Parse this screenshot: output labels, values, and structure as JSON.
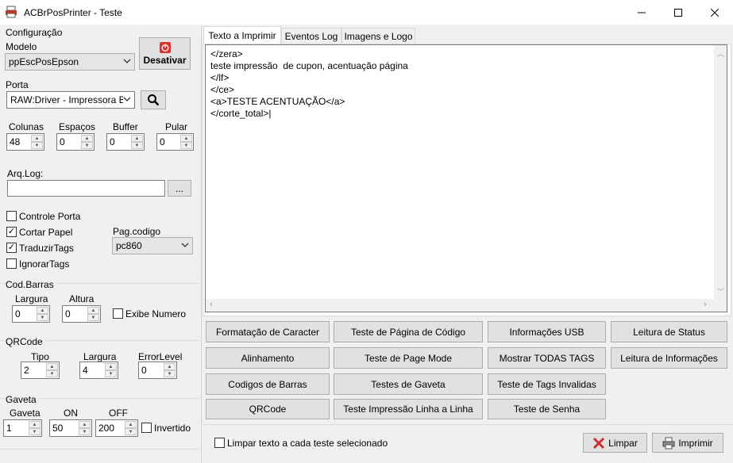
{
  "window": {
    "title": "ACBrPosPrinter - Teste",
    "minimize": "—",
    "maximize": "☐",
    "close": "✕"
  },
  "config": {
    "section_label": "Configuração",
    "modelo_label": "Modelo",
    "modelo_value": "ppEscPosEpson",
    "desativar_label": "Desativar",
    "porta_label": "Porta",
    "porta_value": "RAW:Driver - Impressora B",
    "colunas_label": "Colunas",
    "colunas_value": "48",
    "espacos_label": "Espaços",
    "espacos_value": "0",
    "buffer_label": "Buffer",
    "buffer_value": "0",
    "pular_label": "Pular",
    "pular_value": "0",
    "arqlog_label": "Arq.Log:",
    "arqlog_value": "",
    "browse_label": "...",
    "controle_porta_label": "Controle Porta",
    "controle_porta_checked": false,
    "cortar_papel_label": "Cortar Papel",
    "cortar_papel_checked": true,
    "traduzir_tags_label": "TraduzirTags",
    "traduzir_tags_checked": true,
    "ignorar_tags_label": "IgnorarTags",
    "ignorar_tags_checked": false,
    "pagcodigo_label": "Pag.codigo",
    "pagcodigo_value": "pc860"
  },
  "codbarras": {
    "section_label": "Cod.Barras",
    "largura_label": "Largura",
    "largura_value": "0",
    "altura_label": "Altura",
    "altura_value": "0",
    "exibe_numero_label": "Exibe Numero",
    "exibe_numero_checked": false
  },
  "qrcode": {
    "section_label": "QRCode",
    "tipo_label": "Tipo",
    "tipo_value": "2",
    "largura_label": "Largura",
    "largura_value": "4",
    "errorlevel_label": "ErrorLevel",
    "errorlevel_value": "0"
  },
  "gaveta": {
    "section_label": "Gaveta",
    "gaveta_label": "Gaveta",
    "gaveta_value": "1",
    "on_label": "ON",
    "on_value": "50",
    "off_label": "OFF",
    "off_value": "200",
    "invertido_label": "Invertido",
    "invertido_checked": false
  },
  "tabs": [
    {
      "label": "Texto a Imprimir",
      "active": true
    },
    {
      "label": "Eventos Log",
      "active": false
    },
    {
      "label": "Imagens e Logo",
      "active": false
    }
  ],
  "editor": {
    "lines": [
      "</zera>",
      "teste impressão  de cupon, acentuação página",
      "</lf>",
      "</ce>",
      "<a>TESTE ACENTUAÇÃO</a>",
      "</corte_total>"
    ]
  },
  "actions": [
    [
      "Formatação de Caracter",
      "Teste de Página de Código",
      "Informações USB",
      "Leitura de Status"
    ],
    [
      "Alinhamento",
      "Teste de Page Mode",
      "Mostrar TODAS TAGS",
      "Leitura de Informações"
    ],
    [
      "Codigos de Barras",
      "Testes de Gaveta",
      "Teste de Tags Invalidas"
    ],
    [
      "QRCode",
      "Teste Impressão Linha a Linha",
      "Teste de Senha"
    ]
  ],
  "footer": {
    "limpar_texto_label": "Limpar texto a cada teste selecionado",
    "limpar_texto_checked": false,
    "limpar_button": "Limpar",
    "imprimir_button": "Imprimir"
  },
  "colors": {
    "power_icon": "#e03030",
    "limpar_icon": "#d03030"
  }
}
